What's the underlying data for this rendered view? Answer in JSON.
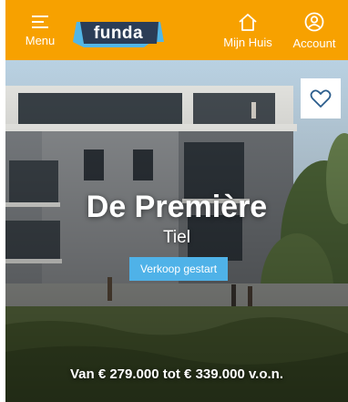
{
  "header": {
    "menu_label": "Menu",
    "logo_text": "funda",
    "home_label": "Mijn Huis",
    "account_label": "Account"
  },
  "project": {
    "name": "De Première",
    "city": "Tiel",
    "status": "Verkoop gestart",
    "price": "Van € 279.000 tot € 339.000 v.o.n."
  },
  "icons": {
    "menu": "hamburger-icon",
    "home": "house-icon",
    "account": "user-icon",
    "favorite": "heart-icon"
  },
  "colors": {
    "brand": "#F7A100",
    "logo_bg": "#2B3D57",
    "logo_accent": "#52B6E6",
    "badge": "#4FB2E8"
  }
}
